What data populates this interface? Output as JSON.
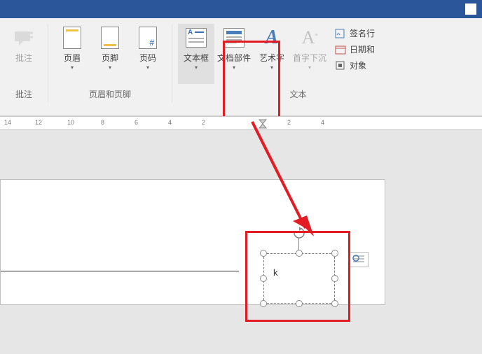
{
  "ribbon": {
    "groups": {
      "comments": {
        "label": "批注",
        "buttons": {
          "comment": "批注"
        }
      },
      "headerfooter": {
        "label": "页眉和页脚",
        "buttons": {
          "header": "页眉",
          "footer": "页脚",
          "pagenum": "页码"
        }
      },
      "text": {
        "label": "文本",
        "buttons": {
          "textbox": "文本框",
          "quickparts": "文档部件",
          "wordart": "艺术字",
          "dropcap": "首字下沉"
        },
        "small": {
          "signature": "签名行",
          "datetime": "日期和",
          "object": "对象"
        }
      }
    }
  },
  "ruler": {
    "ticks": [
      "14",
      "12",
      "10",
      "8",
      "6",
      "4",
      "2",
      "2",
      "4"
    ]
  },
  "textbox": {
    "cursor_glyph": "k"
  },
  "colors": {
    "accent": "#2b579a",
    "warn": "#e41b23"
  }
}
